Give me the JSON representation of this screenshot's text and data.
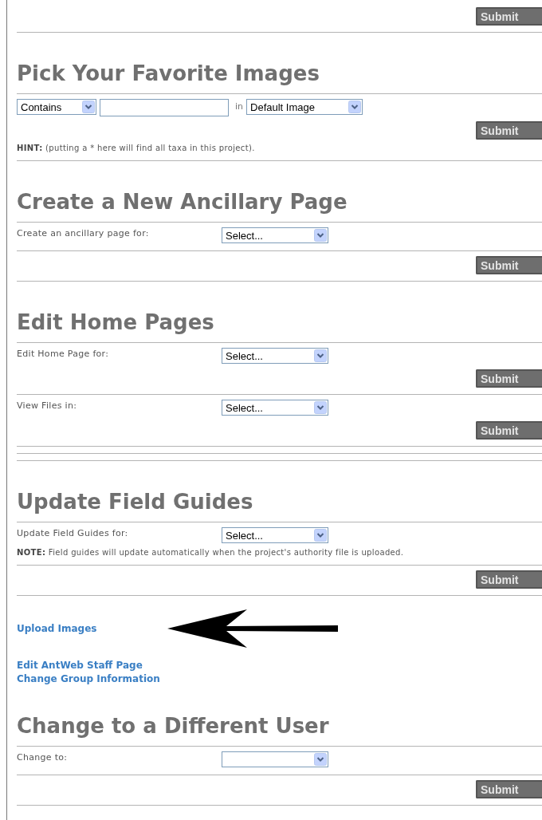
{
  "blocks": [
    {
      "kind": "submit",
      "label": "Submit"
    },
    {
      "kind": "rule"
    },
    {
      "kind": "heading",
      "text": "Pick Your Favorite Images"
    },
    {
      "kind": "rule"
    },
    {
      "kind": "search_row",
      "match": "Contains",
      "in_label": "in",
      "field": "Default Image"
    },
    {
      "kind": "submit",
      "label": "Submit"
    },
    {
      "kind": "hint",
      "text": "**HINT:** (putting a * here will find all taxa in this project)."
    },
    {
      "kind": "rule"
    },
    {
      "kind": "heading",
      "text": "Create a New Ancillary Page"
    },
    {
      "kind": "rule"
    },
    {
      "kind": "select_row",
      "label": "Create an ancillary page for:",
      "value": "Select..."
    },
    {
      "kind": "rule"
    },
    {
      "kind": "submit",
      "label": "Submit"
    },
    {
      "kind": "rule"
    },
    {
      "kind": "heading",
      "text": "Edit Home Pages"
    },
    {
      "kind": "rule"
    },
    {
      "kind": "select_row",
      "label": "Edit Home Page for:",
      "value": "Select..."
    },
    {
      "kind": "submit",
      "label": "Submit"
    },
    {
      "kind": "rule"
    },
    {
      "kind": "select_row",
      "label": "View Files in:",
      "value": "Select..."
    },
    {
      "kind": "submit",
      "label": "Submit"
    },
    {
      "kind": "rule"
    },
    {
      "kind": "rule"
    },
    {
      "kind": "rule"
    },
    {
      "kind": "heading",
      "text": "Update Field Guides"
    },
    {
      "kind": "rule"
    },
    {
      "kind": "select_row",
      "label": "Update Field Guides for:",
      "value": "Select..."
    },
    {
      "kind": "hint",
      "text": "**NOTE:** Field guides will update automatically when the project's authority file is uploaded."
    },
    {
      "kind": "rule"
    },
    {
      "kind": "submit",
      "label": "Submit"
    },
    {
      "kind": "rule"
    },
    {
      "kind": "links",
      "groups": [
        [
          {
            "text": "Upload Images",
            "arrow": true
          }
        ],
        [
          {
            "text": "Edit AntWeb Staff Page",
            "arrow": false
          },
          {
            "text": "Change Group Information",
            "arrow": false
          }
        ]
      ]
    },
    {
      "kind": "heading",
      "text": "Change to a Different User"
    },
    {
      "kind": "rule"
    },
    {
      "kind": "select_row",
      "label": "Change to:"
    },
    {
      "kind": "rule"
    },
    {
      "kind": "submit",
      "label": "Submit"
    },
    {
      "kind": "rule"
    }
  ]
}
